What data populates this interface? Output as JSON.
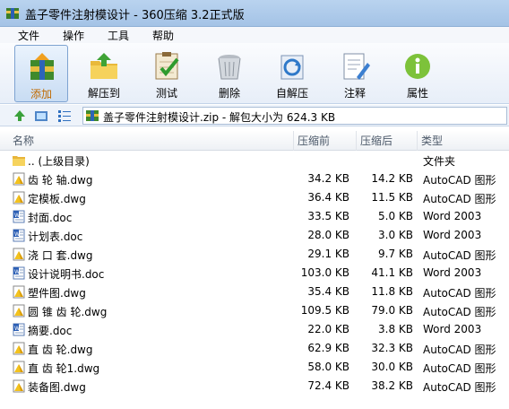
{
  "window": {
    "title": "盖子零件注射模设计 - 360压缩 3.2正式版"
  },
  "menu": {
    "items": [
      "文件",
      "操作",
      "工具",
      "帮助"
    ]
  },
  "toolbar": {
    "buttons": [
      {
        "label": "添加",
        "icon": "add-archive-icon"
      },
      {
        "label": "解压到",
        "icon": "extract-folder-icon"
      },
      {
        "label": "测试",
        "icon": "test-checklist-icon"
      },
      {
        "label": "删除",
        "icon": "delete-bin-icon"
      },
      {
        "label": "自解压",
        "icon": "self-extract-icon"
      },
      {
        "label": "注释",
        "icon": "comment-edit-icon"
      },
      {
        "label": "属性",
        "icon": "info-icon"
      }
    ]
  },
  "address": {
    "path": "盖子零件注射模设计.zip - 解包大小为 624.3 KB"
  },
  "columns": {
    "name": "名称",
    "size": "压缩前",
    "packed": "压缩后",
    "type": "类型"
  },
  "files": [
    {
      "name": ".. (上级目录)",
      "size": "",
      "packed": "",
      "type": "文件夹",
      "kind": "folder"
    },
    {
      "name": "齿 轮 轴.dwg",
      "size": "34.2 KB",
      "packed": "14.2 KB",
      "type": "AutoCAD 图形",
      "kind": "dwg"
    },
    {
      "name": "定模板.dwg",
      "size": "36.4 KB",
      "packed": "11.5 KB",
      "type": "AutoCAD 图形",
      "kind": "dwg"
    },
    {
      "name": "封面.doc",
      "size": "33.5 KB",
      "packed": "5.0 KB",
      "type": "Word 2003",
      "kind": "doc"
    },
    {
      "name": "计划表.doc",
      "size": "28.0 KB",
      "packed": "3.0 KB",
      "type": "Word 2003",
      "kind": "doc"
    },
    {
      "name": "浇 口 套.dwg",
      "size": "29.1 KB",
      "packed": "9.7 KB",
      "type": "AutoCAD 图形",
      "kind": "dwg"
    },
    {
      "name": "设计说明书.doc",
      "size": "103.0 KB",
      "packed": "41.1 KB",
      "type": "Word 2003",
      "kind": "doc"
    },
    {
      "name": "塑件图.dwg",
      "size": "35.4 KB",
      "packed": "11.8 KB",
      "type": "AutoCAD 图形",
      "kind": "dwg"
    },
    {
      "name": "圆 锥 齿 轮.dwg",
      "size": "109.5 KB",
      "packed": "79.0 KB",
      "type": "AutoCAD 图形",
      "kind": "dwg"
    },
    {
      "name": "摘要.doc",
      "size": "22.0 KB",
      "packed": "3.8 KB",
      "type": "Word 2003",
      "kind": "doc"
    },
    {
      "name": "直 齿 轮.dwg",
      "size": "62.9 KB",
      "packed": "32.3 KB",
      "type": "AutoCAD 图形",
      "kind": "dwg"
    },
    {
      "name": "直 齿 轮1.dwg",
      "size": "58.0 KB",
      "packed": "30.0 KB",
      "type": "AutoCAD 图形",
      "kind": "dwg"
    },
    {
      "name": "装备图.dwg",
      "size": "72.4 KB",
      "packed": "38.2 KB",
      "type": "AutoCAD 图形",
      "kind": "dwg"
    }
  ]
}
